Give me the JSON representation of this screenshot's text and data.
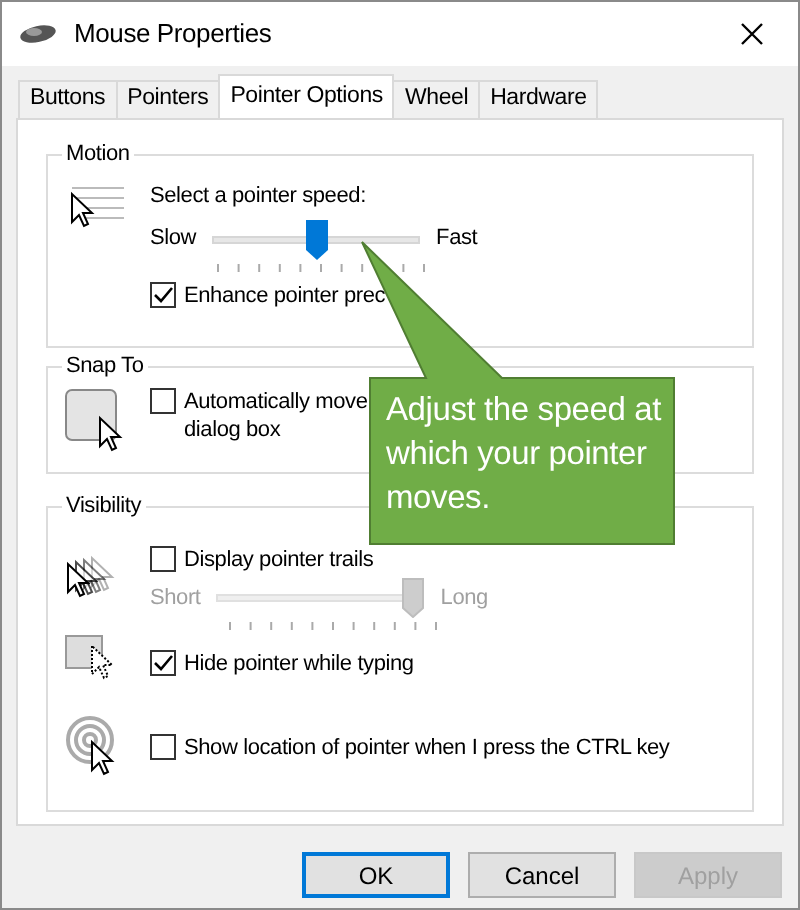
{
  "window": {
    "title": "Mouse Properties"
  },
  "tabs": [
    {
      "label": "Buttons",
      "selected": false
    },
    {
      "label": "Pointers",
      "selected": false
    },
    {
      "label": "Pointer Options",
      "selected": true
    },
    {
      "label": "Wheel",
      "selected": false
    },
    {
      "label": "Hardware",
      "selected": false
    }
  ],
  "motion": {
    "title": "Motion",
    "label": "Select a pointer speed:",
    "slider": {
      "min_label": "Slow",
      "max_label": "Fast",
      "level": 0.5,
      "disabled": false
    },
    "option": {
      "label": "Enhance pointer prec",
      "checked": true
    }
  },
  "snap_to": {
    "title": "Snap To",
    "option": {
      "label_lines": [
        "Automatically move",
        "dialog box"
      ],
      "checked": false
    }
  },
  "visibility": {
    "title": "Visibility",
    "trails": {
      "label": "Display pointer trails",
      "checked": false,
      "slider": {
        "min_label": "Short",
        "max_label": "Long",
        "level": 1,
        "disabled": true
      }
    },
    "options": [
      {
        "kind": "hide",
        "label": "Hide pointer while typing",
        "checked": true
      },
      {
        "kind": "locate",
        "label": "Show location of pointer when I press the CTRL key",
        "checked": false
      }
    ]
  },
  "buttons": [
    {
      "label": "OK",
      "kind": "default",
      "disabled": false
    },
    {
      "label": "Cancel",
      "kind": "normal",
      "disabled": false
    },
    {
      "label": "Apply",
      "kind": "normal",
      "disabled": true
    }
  ],
  "callout": {
    "text": "Adjust the speed at which your pointer moves."
  }
}
